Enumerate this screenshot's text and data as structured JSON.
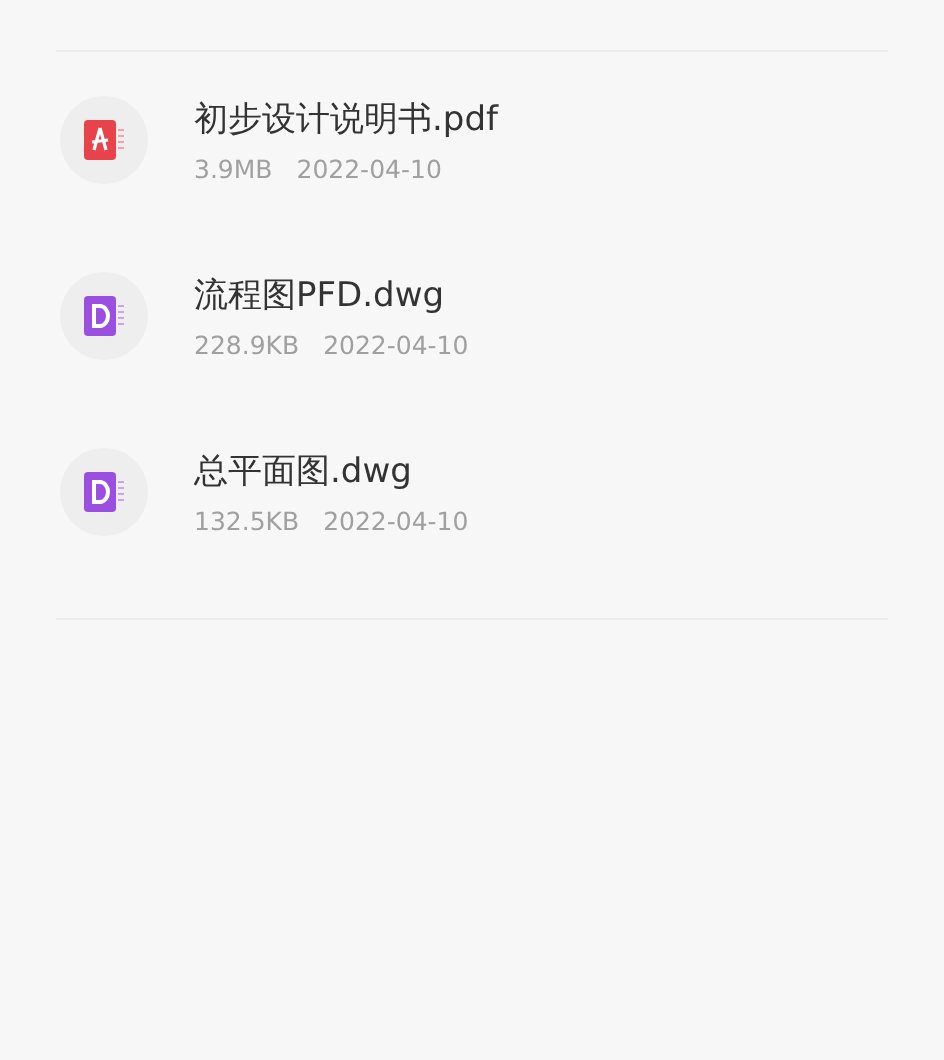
{
  "files": [
    {
      "kind": "pdf",
      "name": "初步设计说明书.pdf",
      "size": "3.9MB",
      "date": "2022-04-10"
    },
    {
      "kind": "dwg",
      "name": "流程图PFD.dwg",
      "size": "228.9KB",
      "date": "2022-04-10"
    },
    {
      "kind": "dwg",
      "name": "总平面图.dwg",
      "size": "132.5KB",
      "date": "2022-04-10"
    }
  ]
}
